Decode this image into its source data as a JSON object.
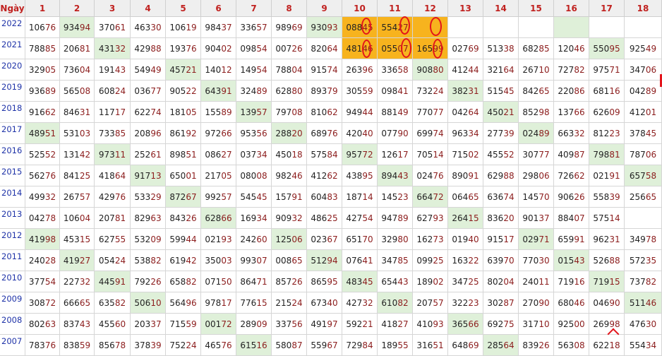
{
  "header": {
    "corner_label": "Ngày",
    "columns": [
      "1",
      "2",
      "3",
      "4",
      "5",
      "6",
      "7",
      "8",
      "9",
      "10",
      "11",
      "12",
      "13",
      "14",
      "15",
      "16",
      "17",
      "18"
    ]
  },
  "rows": [
    {
      "year": "2022",
      "cells": [
        "10676",
        "93494",
        "37061",
        "46330",
        "10619",
        "98437",
        "33657",
        "98969",
        "93093",
        "08845",
        "55427",
        "",
        "",
        "",
        "",
        "",
        "",
        ""
      ]
    },
    {
      "year": "2021",
      "cells": [
        "78885",
        "20681",
        "43132",
        "42988",
        "19376",
        "90402",
        "09854",
        "00726",
        "82064",
        "48146",
        "05507",
        "16599",
        "02769",
        "51338",
        "68285",
        "12046",
        "55095",
        "92549"
      ]
    },
    {
      "year": "2020",
      "cells": [
        "32905",
        "73604",
        "19143",
        "54949",
        "45721",
        "14012",
        "14954",
        "78804",
        "91574",
        "26396",
        "33658",
        "90880",
        "41244",
        "32164",
        "26710",
        "72782",
        "97571",
        "34706"
      ]
    },
    {
      "year": "2019",
      "cells": [
        "93689",
        "56508",
        "60824",
        "03677",
        "90522",
        "64391",
        "32489",
        "62880",
        "89379",
        "30559",
        "09841",
        "73224",
        "38231",
        "51545",
        "84265",
        "22086",
        "68116",
        "04289"
      ]
    },
    {
      "year": "2018",
      "cells": [
        "91662",
        "84631",
        "11717",
        "62274",
        "18105",
        "15589",
        "13957",
        "79708",
        "81062",
        "94944",
        "88149",
        "77077",
        "04264",
        "45021",
        "85298",
        "13766",
        "62609",
        "41201"
      ]
    },
    {
      "year": "2017",
      "cells": [
        "48951",
        "53103",
        "73385",
        "20896",
        "86192",
        "97266",
        "95356",
        "28820",
        "68976",
        "42040",
        "07790",
        "69974",
        "96334",
        "27739",
        "02489",
        "66332",
        "81223",
        "37845"
      ]
    },
    {
      "year": "2016",
      "cells": [
        "52552",
        "13142",
        "97311",
        "25261",
        "89851",
        "08627",
        "03734",
        "45018",
        "57584",
        "95772",
        "12617",
        "70514",
        "71502",
        "45552",
        "30777",
        "40987",
        "79881",
        "78706"
      ]
    },
    {
      "year": "2015",
      "cells": [
        "56276",
        "84125",
        "41864",
        "91713",
        "65001",
        "21705",
        "08008",
        "98246",
        "41262",
        "43895",
        "89443",
        "02476",
        "89091",
        "62988",
        "29806",
        "72662",
        "02191",
        "65758"
      ]
    },
    {
      "year": "2014",
      "cells": [
        "49932",
        "26757",
        "42976",
        "53329",
        "87267",
        "99257",
        "54545",
        "15791",
        "60483",
        "18714",
        "14523",
        "66472",
        "06465",
        "63674",
        "14570",
        "90626",
        "55839",
        "25665"
      ]
    },
    {
      "year": "2013",
      "cells": [
        "04278",
        "10604",
        "20781",
        "82963",
        "84326",
        "62866",
        "16934",
        "90932",
        "48625",
        "42754",
        "94789",
        "62793",
        "26415",
        "83620",
        "90137",
        "88407",
        "57514",
        ""
      ]
    },
    {
      "year": "2012",
      "cells": [
        "41998",
        "45315",
        "62755",
        "53209",
        "59944",
        "02193",
        "24260",
        "12506",
        "02367",
        "65170",
        "32980",
        "16273",
        "01940",
        "91517",
        "02971",
        "65991",
        "96231",
        "34978"
      ]
    },
    {
      "year": "2011",
      "cells": [
        "24028",
        "41927",
        "05424",
        "53882",
        "61942",
        "35003",
        "99307",
        "00865",
        "51294",
        "07641",
        "34785",
        "09925",
        "16322",
        "63970",
        "77030",
        "01543",
        "52688",
        "57235"
      ]
    },
    {
      "year": "2010",
      "cells": [
        "37754",
        "22732",
        "44591",
        "79226",
        "65882",
        "07150",
        "86471",
        "85726",
        "86595",
        "48345",
        "65443",
        "18902",
        "34725",
        "80204",
        "24011",
        "71916",
        "71915",
        "73782"
      ]
    },
    {
      "year": "2009",
      "cells": [
        "30872",
        "66665",
        "63582",
        "50610",
        "56496",
        "97817",
        "77615",
        "21524",
        "67340",
        "42732",
        "61082",
        "20757",
        "32223",
        "30287",
        "27090",
        "68046",
        "04690",
        "51146"
      ]
    },
    {
      "year": "2008",
      "cells": [
        "80263",
        "83743",
        "45560",
        "20337",
        "71559",
        "00172",
        "28909",
        "33756",
        "49197",
        "59221",
        "41827",
        "41093",
        "36566",
        "69275",
        "31710",
        "92500",
        "26998",
        "47630"
      ]
    },
    {
      "year": "2007",
      "cells": [
        "78376",
        "83859",
        "85678",
        "37839",
        "75224",
        "46576",
        "61516",
        "58087",
        "55967",
        "72984",
        "18955",
        "31651",
        "64869",
        "28564",
        "83926",
        "56308",
        "62218",
        "55434"
      ]
    }
  ],
  "highlights": {
    "green": [
      [
        0,
        1
      ],
      [
        0,
        8
      ],
      [
        0,
        15
      ],
      [
        1,
        2
      ],
      [
        1,
        16
      ],
      [
        2,
        4
      ],
      [
        2,
        11
      ],
      [
        3,
        5
      ],
      [
        3,
        12
      ],
      [
        4,
        6
      ],
      [
        4,
        13
      ],
      [
        5,
        0
      ],
      [
        5,
        7
      ],
      [
        5,
        14
      ],
      [
        6,
        2
      ],
      [
        6,
        9
      ],
      [
        6,
        16
      ],
      [
        7,
        3
      ],
      [
        7,
        10
      ],
      [
        7,
        17
      ],
      [
        8,
        4
      ],
      [
        8,
        11
      ],
      [
        9,
        5
      ],
      [
        9,
        12
      ],
      [
        10,
        0
      ],
      [
        10,
        7
      ],
      [
        10,
        14
      ],
      [
        11,
        1
      ],
      [
        11,
        8
      ],
      [
        11,
        15
      ],
      [
        12,
        2
      ],
      [
        12,
        9
      ],
      [
        12,
        16
      ],
      [
        13,
        3
      ],
      [
        13,
        10
      ],
      [
        13,
        17
      ],
      [
        14,
        5
      ],
      [
        14,
        12
      ],
      [
        15,
        6
      ],
      [
        15,
        13
      ]
    ],
    "orange": [
      [
        0,
        9
      ],
      [
        0,
        10
      ],
      [
        0,
        11
      ],
      [
        1,
        9
      ],
      [
        1,
        10
      ],
      [
        1,
        11
      ]
    ]
  },
  "colors": {
    "header_text": "#c0211f",
    "year_text": "#1f33a8",
    "green_fill": "#dff0d9",
    "orange_fill": "#f7b31e",
    "marker_red": "#e3141b"
  }
}
